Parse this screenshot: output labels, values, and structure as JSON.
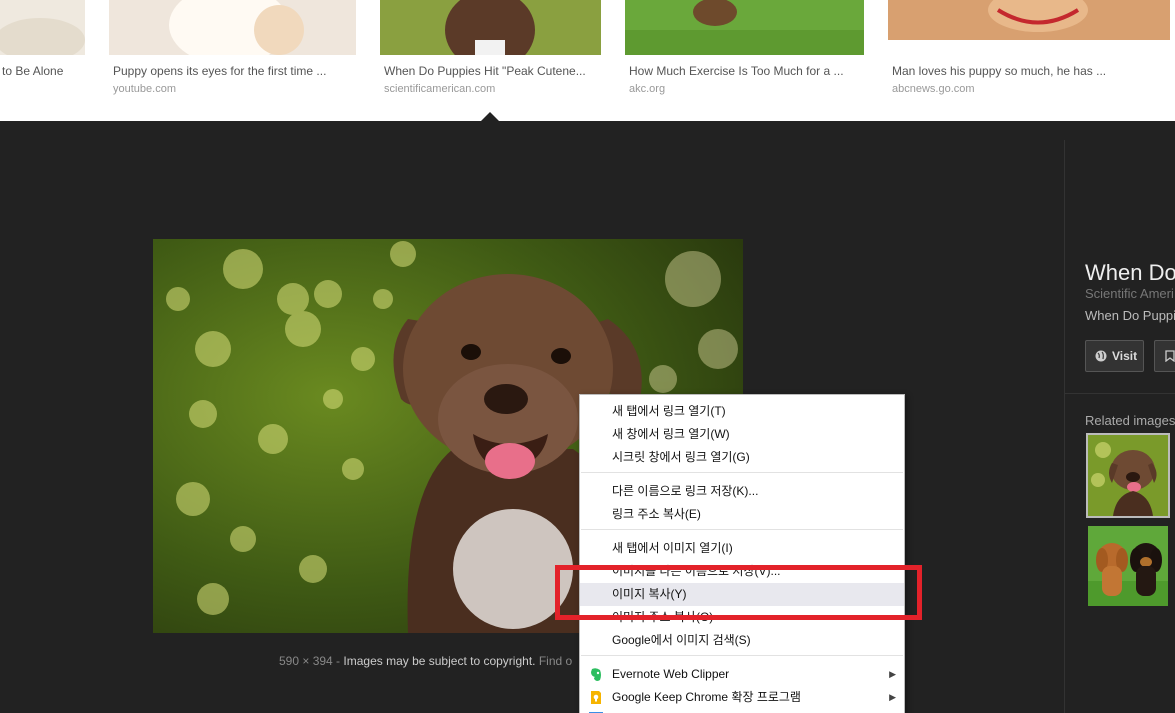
{
  "results": [
    {
      "title": "to Be Alone",
      "domain": ""
    },
    {
      "title": "Puppy opens its eyes for the first time ...",
      "domain": "youtube.com"
    },
    {
      "title": "When Do Puppies Hit \"Peak Cutene...",
      "domain": "scientificamerican.com"
    },
    {
      "title": "How Much Exercise Is Too Much for a ...",
      "domain": "akc.org"
    },
    {
      "title": "Man loves his puppy so much, he has ...",
      "domain": "abcnews.go.com"
    }
  ],
  "main": {
    "dimensions": "590 × 394",
    "separator": " - ",
    "copyright": "Images may be subject to copyright.",
    "find_more": " Find o"
  },
  "side": {
    "title": "When Do",
    "source": "Scientific Ameri",
    "description": "When Do Puppi",
    "visit_label": "Visit",
    "related_label": "Related images"
  },
  "context_menu": {
    "items": [
      {
        "label": "새 탭에서 링크 열기(T)"
      },
      {
        "label": "새 창에서 링크 열기(W)"
      },
      {
        "label": "시크릿 창에서 링크 열기(G)"
      },
      {
        "label": "다른 이름으로 링크 저장(K)..."
      },
      {
        "label": "링크 주소 복사(E)"
      },
      {
        "label": "새 탭에서 이미지 열기(I)"
      },
      {
        "label": "이미지를 다른 이름으로 저장(V)..."
      },
      {
        "label": "이미지 복사(Y)"
      },
      {
        "label": "이미지 주소 복사(O)"
      },
      {
        "label": "Google에서 이미지 검색(S)"
      },
      {
        "label": "Evernote Web Clipper"
      },
      {
        "label": "Google Keep Chrome 확장 프로그램"
      }
    ],
    "highlighted": "이미지 복사(Y)"
  },
  "colors": {
    "background": "#222222",
    "highlight": "#e3222a",
    "evernote": "#2dbe60",
    "keep": "#f6b400"
  },
  "icons": {
    "visit": "globe-icon",
    "save": "bookmark-icon",
    "evernote": "evernote-icon",
    "keep": "keep-icon",
    "submenu": "chevron-right-icon"
  }
}
